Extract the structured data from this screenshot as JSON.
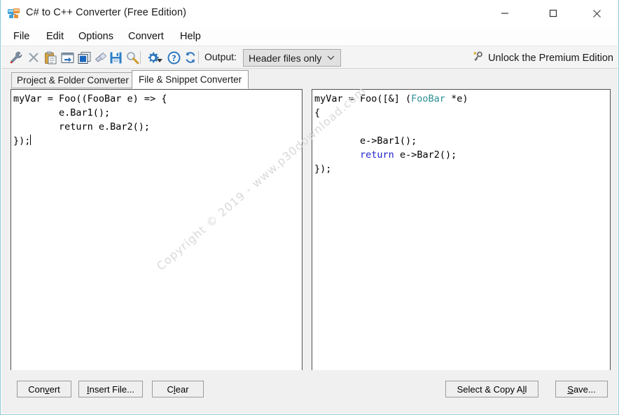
{
  "window": {
    "title": "C# to C++ Converter (Free Edition)",
    "icon": "converter-app-icon",
    "border_color": "#8ec8d4",
    "controls": {
      "minimize": "minimize-icon",
      "maximize": "maximize-icon",
      "close": "close-icon"
    }
  },
  "menubar": {
    "items": [
      {
        "label": "File"
      },
      {
        "label": "Edit"
      },
      {
        "label": "Options"
      },
      {
        "label": "Convert"
      },
      {
        "label": "Help"
      }
    ]
  },
  "toolbar": {
    "icons": [
      {
        "name": "wrench-icon"
      },
      {
        "name": "delete-x-icon"
      },
      {
        "name": "paste-icon"
      },
      {
        "name": "insert-file-icon"
      },
      {
        "name": "select-all-icon"
      },
      {
        "name": "clear-eraser-icon"
      },
      {
        "name": "save-icon"
      },
      {
        "name": "search-icon"
      },
      {
        "name": "settings-gear-icon"
      },
      {
        "name": "help-question-icon"
      },
      {
        "name": "refresh-icon"
      }
    ],
    "output_label": "Output:",
    "output_value": "Header files only",
    "output_options": [
      "Header files only"
    ],
    "unlock_text": "Unlock the Premium Edition",
    "unlock_icon": "key-star-icon"
  },
  "tabs": [
    {
      "label": "Project & Folder Converter",
      "active": false
    },
    {
      "label": "File & Snippet Converter",
      "active": true
    }
  ],
  "editors": {
    "source": {
      "name": "csharp-source-editor",
      "lines": [
        "myVar = Foo((FooBar e) => {",
        "        e.Bar1();",
        "        return e.Bar2();",
        "});"
      ]
    },
    "target": {
      "name": "cpp-output-editor",
      "lines": [
        "myVar = Foo([&] (FooBar *e)",
        "{",
        "        e->Bar1();",
        "        return e->Bar2();",
        "});"
      ],
      "syntax_colors": {
        "type": "#2b8f95",
        "keyword": "#2222cc",
        "plain": "#000000"
      }
    }
  },
  "watermark": {
    "text": "Copyright © 2019 - www.p30download.com",
    "color": "#d9d9d9"
  },
  "buttons": {
    "convert": {
      "pre": "Con",
      "accel": "v",
      "post": "ert"
    },
    "insert_file": {
      "pre": "",
      "accel": "I",
      "post": "nsert File..."
    },
    "clear": {
      "pre": "C",
      "accel": "l",
      "post": "ear"
    },
    "select_copy": {
      "pre": "Select & Copy A",
      "accel": "l",
      "post": "l"
    },
    "save": {
      "pre": "",
      "accel": "S",
      "post": "ave..."
    }
  }
}
